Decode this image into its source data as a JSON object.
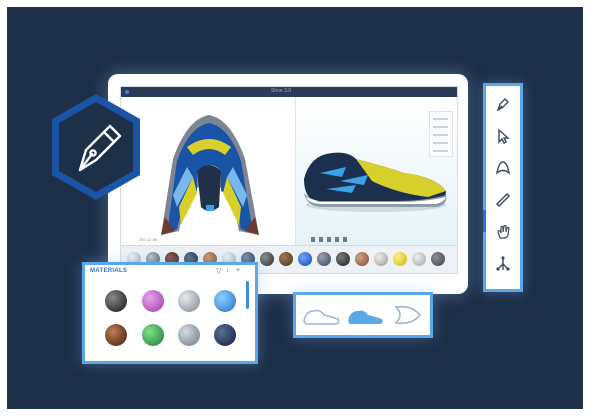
{
  "window": {
    "title": "Shoe 3.0"
  },
  "status": {
    "coords": "267 12 36"
  },
  "materials": {
    "header": "MATERIALS"
  },
  "toolbar": {
    "tools": [
      "pen-tool-icon",
      "select-arrow-icon",
      "shape-icon",
      "ruler-icon",
      "hand-pan-icon",
      "node-tree-icon"
    ]
  },
  "views": {
    "items": [
      "side-view-shoe-icon",
      "profile-view-shoe-icon",
      "top-view-shoe-icon"
    ]
  },
  "colors": {
    "background": "#1e2f48",
    "accent": "#2b72c9",
    "highlight_yellow": "#d7cf2b",
    "shoe_blue": "#1a54a6"
  }
}
